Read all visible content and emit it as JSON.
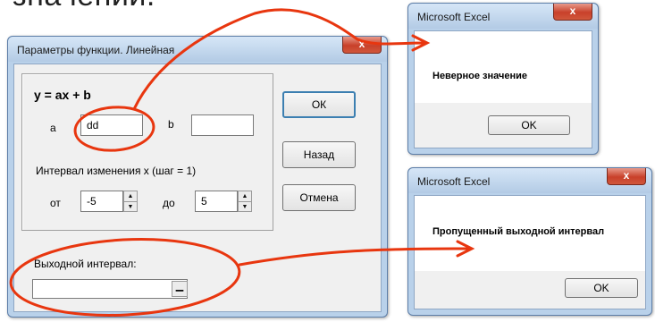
{
  "heading": {
    "text": "значений."
  },
  "dialog": {
    "title": "Параметры функции. Линейная",
    "close_symbol": "x",
    "formula": "y = ax + b",
    "a_label": "a",
    "a_value": "dd",
    "b_label": "b",
    "b_value": "",
    "interval_label": "Интервал изменения х (шаг = 1)",
    "from_label": "от",
    "from_value": "-5",
    "to_label": "до",
    "to_value": "5",
    "output_label": "Выходной интервал:",
    "output_value": "",
    "ok_label": "ОК",
    "back_label": "Назад",
    "cancel_label": "Отмена"
  },
  "msgbox1": {
    "title": "Microsoft Excel",
    "close_symbol": "x",
    "message": "Неверное значение",
    "ok_label": "OK"
  },
  "msgbox2": {
    "title": "Microsoft Excel",
    "close_symbol": "x",
    "message": "Пропущенный выходной интервал",
    "ok_label": "OK"
  },
  "colors": {
    "annotation": "#e8360f",
    "title_bar": "#b9d1ea",
    "face": "#f0f0f0"
  },
  "icons": {
    "spin_up": "▲",
    "spin_down": "▼",
    "range_select": "▁"
  }
}
